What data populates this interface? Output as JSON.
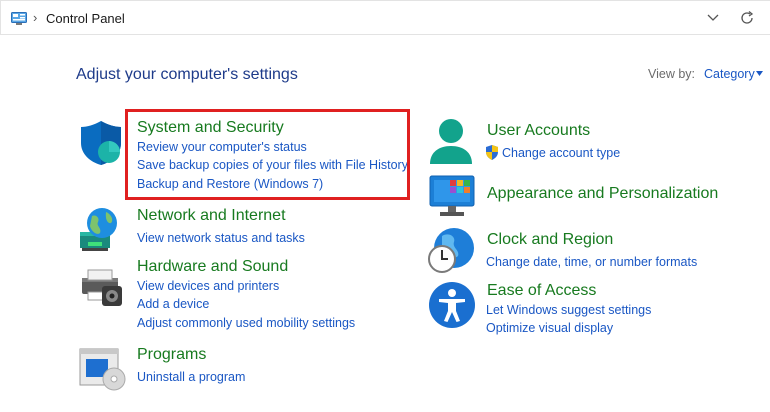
{
  "address_bar": {
    "path_separator": "›",
    "location": "Control Panel"
  },
  "page_title": "Adjust your computer's settings",
  "view_by": {
    "label": "View by:",
    "value": "Category"
  },
  "categories": {
    "system_security": {
      "title": "System and Security",
      "links": [
        "Review your computer's status",
        "Save backup copies of your files with File History",
        "Backup and Restore (Windows 7)"
      ]
    },
    "network": {
      "title": "Network and Internet",
      "links": [
        "View network status and tasks"
      ]
    },
    "hardware": {
      "title": "Hardware and Sound",
      "links": [
        "View devices and printers",
        "Add a device",
        "Adjust commonly used mobility settings"
      ]
    },
    "programs": {
      "title": "Programs",
      "links": [
        "Uninstall a program"
      ]
    },
    "user_accounts": {
      "title": "User Accounts",
      "links": [
        "Change account type"
      ]
    },
    "appearance": {
      "title": "Appearance and Personalization",
      "links": []
    },
    "clock": {
      "title": "Clock and Region",
      "links": [
        "Change date, time, or number formats"
      ]
    },
    "ease": {
      "title": "Ease of Access",
      "links": [
        "Let Windows suggest settings",
        "Optimize visual display"
      ]
    }
  },
  "colors": {
    "title_green": "#177a1f",
    "link_blue": "#1a57c4",
    "heading_blue": "#1e3b8a",
    "highlight_red": "#e02020"
  }
}
